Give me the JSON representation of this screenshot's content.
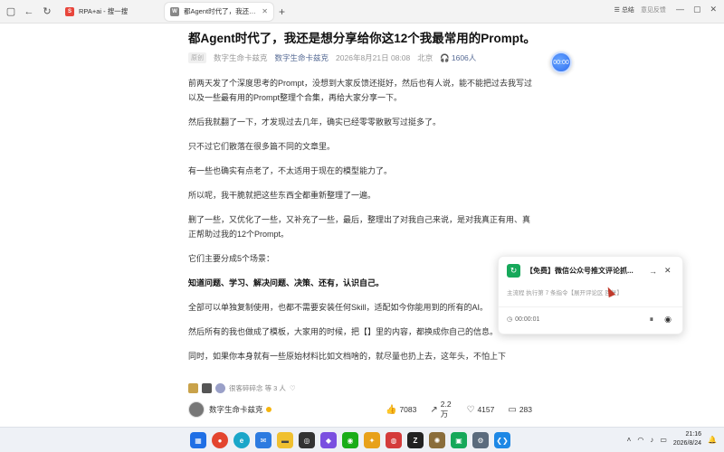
{
  "browser": {
    "tabs": [
      {
        "title": "RPA+ai - 搜一搜",
        "active": false
      },
      {
        "title": "都Agent时代了，我还是想分",
        "active": true
      }
    ],
    "summary_label": "总结",
    "feedback_label": "意见反馈"
  },
  "article": {
    "title": "都Agent时代了，我还是想分享给你这12个我最常用的Prompt。",
    "tag": "原创",
    "author": "数字生命卡兹克",
    "account": "数字生命卡兹克",
    "date": "2026年8月21日 08:08",
    "location": "北京",
    "listen_count": "1606人",
    "paragraphs": [
      {
        "text": "前两天发了个深度思考的Prompt，没想到大家反馈还挺好，然后也有人说，能不能把过去我写过以及一些最有用的Prompt整理个合集，再给大家分享一下。",
        "bold": false
      },
      {
        "text": "然后我就翻了一下，才发现过去几年，确实已经零零散散写过挺多了。",
        "bold": false
      },
      {
        "text": "只不过它们散落在很多篇不同的文章里。",
        "bold": false
      },
      {
        "text": "有一些也确实有点老了，不太适用于现在的模型能力了。",
        "bold": false
      },
      {
        "text": "所以呢，我干脆就把这些东西全都重新整理了一遍。",
        "bold": false
      },
      {
        "text": "删了一些，又优化了一些，又补充了一些，最后，整理出了对我自己来说，是对我真正有用、真正帮助过我的12个Prompt。",
        "bold": false
      },
      {
        "text": "它们主要分成5个场景：",
        "bold": false
      },
      {
        "text": "知道问题、学习、解决问题、决策、还有，认识自己。",
        "bold": true
      },
      {
        "text": "全部可以单独复制使用，也都不需要安装任何Skill，适配如今你能用到的所有的AI。",
        "bold": false
      },
      {
        "text": "然后所有的我也做成了模板，大家用的时候，把【】里的内容，都换成你自己的信息。",
        "bold": false
      },
      {
        "text": "同时，如果你本身就有一些原始材料比如文档啥的，就尽量也扔上去，这年头，不怕上下",
        "bold": false
      }
    ]
  },
  "audio": {
    "time": "00:00"
  },
  "rpa_popup": {
    "name": "【免费】微信公众号推文评论抓...",
    "status": "主流程 执行第 7 条指令【展开评论区 回复】",
    "timer": "00:00:01"
  },
  "readers": {
    "text": "很客碎碎念 等 3 人",
    "heart": "♡"
  },
  "footer": {
    "author": "数字生命卡兹克",
    "likes": "7083",
    "shares": "2.2万",
    "favorites": "4157",
    "comments": "283"
  },
  "taskbar": {
    "time": "21:16",
    "date": "2026/8/24"
  },
  "icons": {
    "back": "arrow-left-icon",
    "forward": "arrow-right-icon",
    "reload": "reload-icon",
    "listen": "headphones-icon",
    "like": "thumbs-up-icon",
    "share": "share-icon",
    "favorite": "heart-icon",
    "comment": "comment-icon"
  },
  "colors": {
    "link": "#576b95",
    "rpa_green": "#16a85a",
    "audio_blue": "#2d6cf0"
  }
}
